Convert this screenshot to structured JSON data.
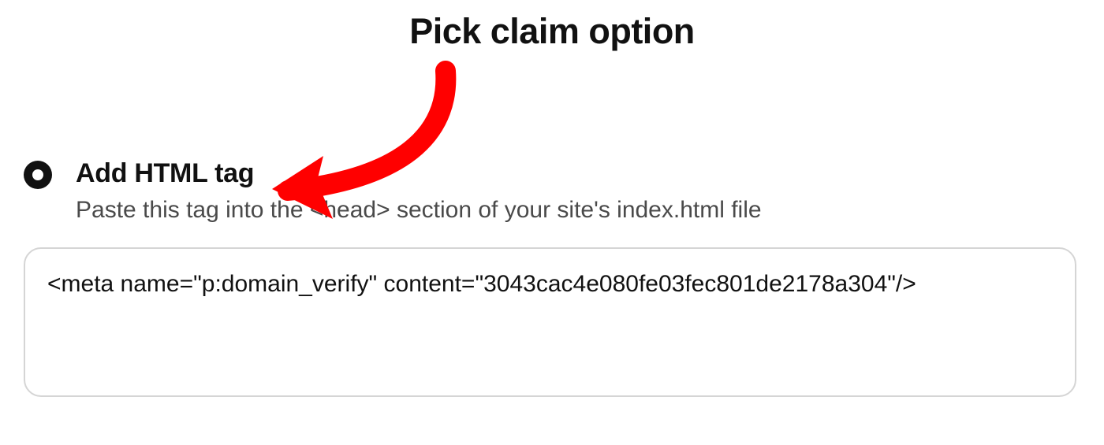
{
  "title": "Pick claim option",
  "option": {
    "label": "Add HTML tag",
    "description": "Paste this tag into the <head> section of your site's index.html file",
    "code": "<meta name=\"p:domain_verify\" content=\"3043cac4e080fe03fec801de2178a304\"/>"
  },
  "annotation": {
    "type": "curved-arrow",
    "color": "#ff0000"
  }
}
